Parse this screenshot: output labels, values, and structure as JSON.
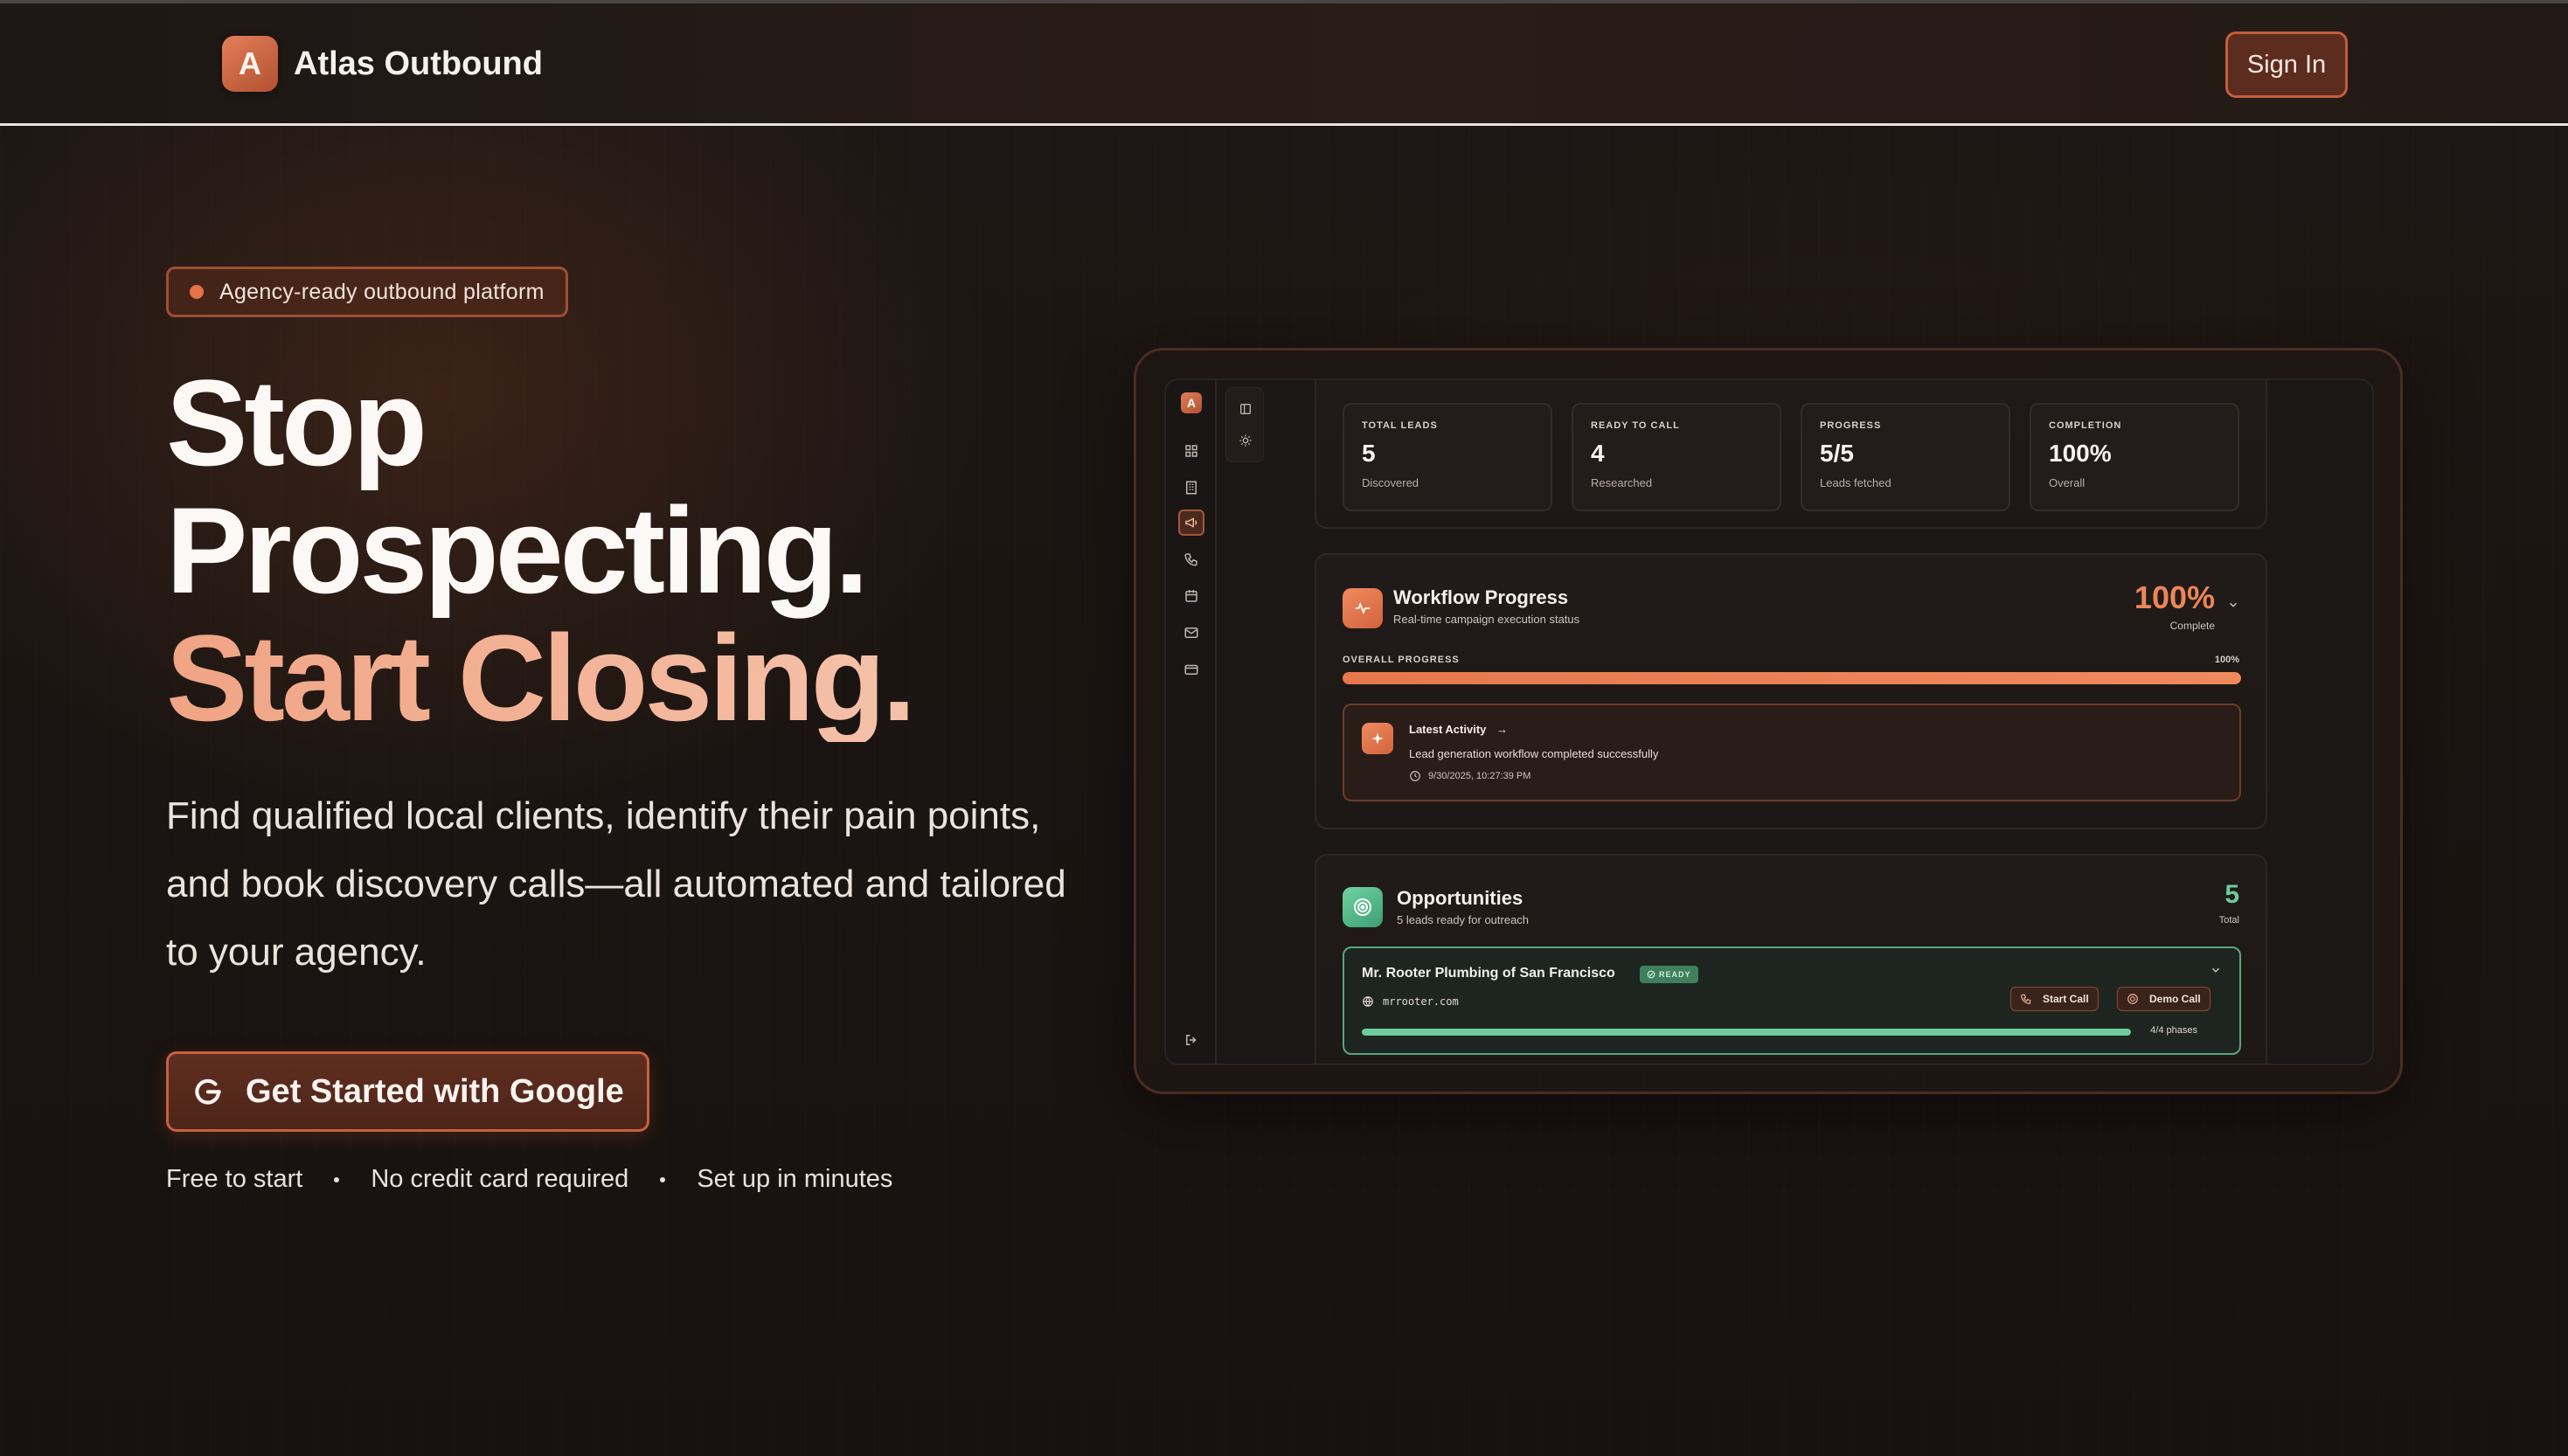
{
  "header": {
    "brand_initial": "A",
    "brand_name": "Atlas Outbound",
    "signin_label": "Sign In"
  },
  "hero": {
    "badge": "Agency-ready outbound platform",
    "headline_line1": "Stop",
    "headline_line2": "Prospecting.",
    "headline_line3": "Start Closing.",
    "subtitle": "Find qualified local clients, identify their pain points, and book discovery calls—all automated and tailored to your agency.",
    "cta_label": "Get Started with Google",
    "perks": [
      "Free to start",
      "No credit card required",
      "Set up in minutes"
    ]
  },
  "preview": {
    "rail_logo": "A",
    "rail_icons": [
      "grid-icon",
      "building-icon",
      "megaphone-icon",
      "phone-icon",
      "calendar-icon",
      "mail-icon",
      "card-icon",
      "logout-icon"
    ],
    "stats": [
      {
        "label": "TOTAL LEADS",
        "value": "5",
        "caption": "Discovered"
      },
      {
        "label": "READY TO CALL",
        "value": "4",
        "caption": "Researched"
      },
      {
        "label": "PROGRESS",
        "value": "5/5",
        "caption": "Leads fetched"
      },
      {
        "label": "COMPLETION",
        "value": "100%",
        "caption": "Overall"
      }
    ],
    "workflow": {
      "title": "Workflow Progress",
      "subtitle": "Real-time campaign execution status",
      "percent": "100%",
      "percent_caption": "Complete",
      "overall_label": "OVERALL PROGRESS",
      "overall_value": "100%",
      "progress_fraction": 1.0,
      "latest_title": "Latest Activity",
      "latest_text": "Lead generation workflow completed successfully",
      "latest_time": "9/30/2025, 10:27:39 PM"
    },
    "opportunities": {
      "title": "Opportunities",
      "subtitle": "5 leads ready for outreach",
      "count": "5",
      "count_caption": "Total",
      "lead": {
        "name": "Mr. Rooter Plumbing of San Francisco",
        "status": "READY",
        "website": "mrrooter.com",
        "start_call": "Start Call",
        "demo_call": "Demo Call",
        "phases": "4/4 phases",
        "phase_fraction": 1.0
      }
    }
  },
  "colors": {
    "accent": "#e8714a",
    "success": "#6ecb9c",
    "background": "#181311"
  }
}
